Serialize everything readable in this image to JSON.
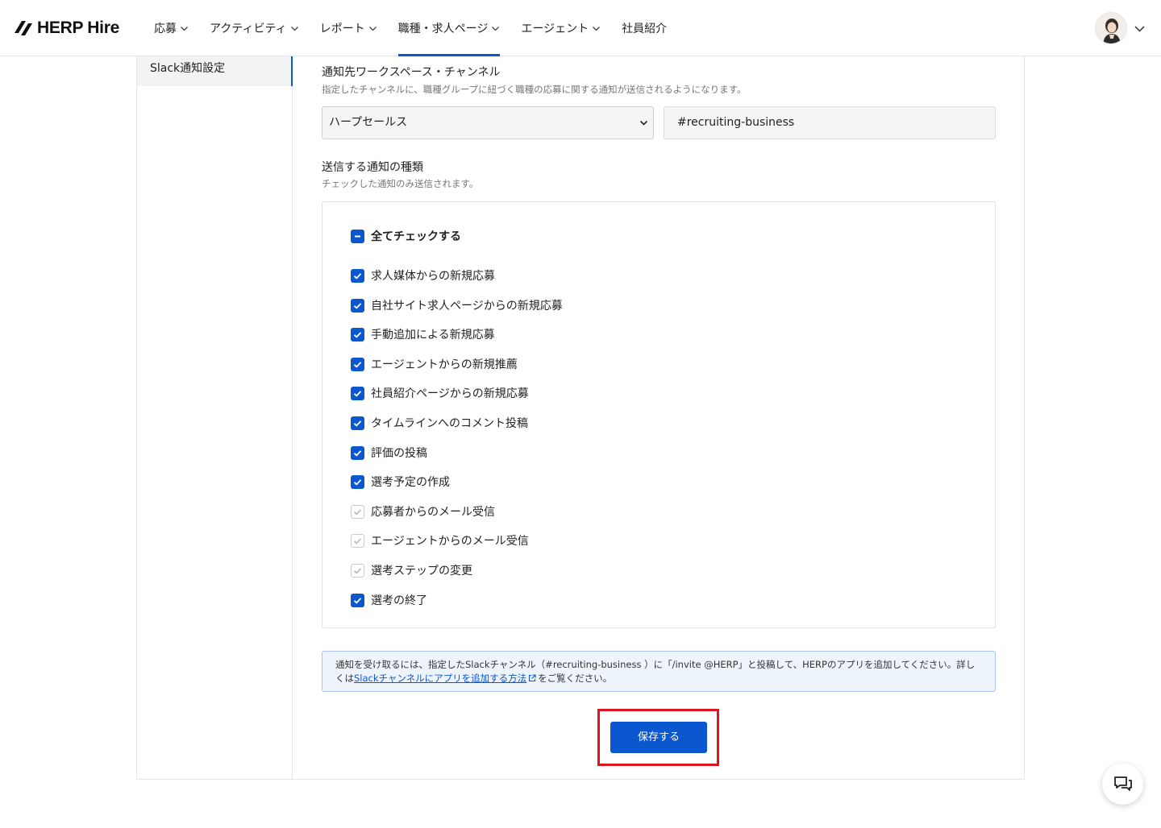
{
  "header": {
    "logo_text": "HERP Hire",
    "nav": [
      {
        "label": "応募",
        "has_dropdown": true,
        "active": false
      },
      {
        "label": "アクティビティ",
        "has_dropdown": true,
        "active": false
      },
      {
        "label": "レポート",
        "has_dropdown": true,
        "active": false
      },
      {
        "label": "職種・求人ページ",
        "has_dropdown": true,
        "active": true
      },
      {
        "label": "エージェント",
        "has_dropdown": true,
        "active": false
      },
      {
        "label": "社員紹介",
        "has_dropdown": false,
        "active": false
      }
    ]
  },
  "sidebar": {
    "active_item": "Slack通知設定"
  },
  "workspace_section": {
    "title": "通知先ワークスペース・チャンネル",
    "description": "指定したチャンネルに、職種グループに紐づく職種の応募に関する通知が送信されるようになります。",
    "workspace_value": "ハープセールス",
    "channel_value": "#recruiting-business"
  },
  "notify_section": {
    "title": "送信する通知の種類",
    "description": "チェックした通知のみ送信されます。",
    "check_all_label": "全てチェックする",
    "items": [
      {
        "label": "求人媒体からの新規応募",
        "checked": true
      },
      {
        "label": "自社サイト求人ページからの新規応募",
        "checked": true
      },
      {
        "label": "手動追加による新規応募",
        "checked": true
      },
      {
        "label": "エージェントからの新規推薦",
        "checked": true
      },
      {
        "label": "社員紹介ページからの新規応募",
        "checked": true
      },
      {
        "label": "タイムラインへのコメント投稿",
        "checked": true
      },
      {
        "label": "評価の投稿",
        "checked": true
      },
      {
        "label": "選考予定の作成",
        "checked": true
      },
      {
        "label": "応募者からのメール受信",
        "checked": false
      },
      {
        "label": "エージェントからのメール受信",
        "checked": false
      },
      {
        "label": "選考ステップの変更",
        "checked": false
      },
      {
        "label": "選考の終了",
        "checked": true
      }
    ]
  },
  "notice": {
    "text_before": "通知を受け取るには、指定したSlackチャンネル（#recruiting-business ）に「/invite @HERP」と投稿して、HERPのアプリを追加してください。詳しくは",
    "link_text": "Slackチャンネルにアプリを追加する方法",
    "text_after": "をご覧ください。"
  },
  "save_label": "保存する",
  "colors": {
    "accent": "#0b57d0",
    "highlight": "#e0141e"
  },
  "icons": [
    "chevron-down-icon",
    "external-link-icon",
    "chat-icon",
    "check-icon",
    "minus-icon"
  ]
}
